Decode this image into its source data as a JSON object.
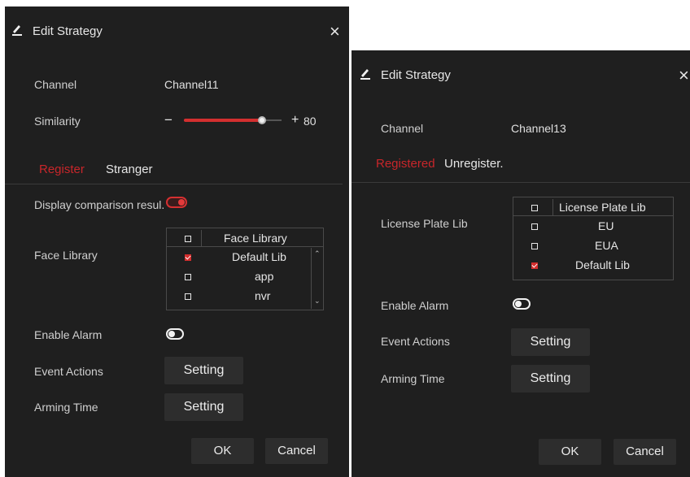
{
  "left": {
    "title": "Edit Strategy",
    "close_glyph": "×",
    "channel_label": "Channel",
    "channel_value": "Channel11",
    "similarity_label": "Similarity",
    "similarity_minus": "−",
    "similarity_plus": "+",
    "similarity_value": "80",
    "similarity_level": 0.8,
    "tabs": [
      "Register",
      "Stranger"
    ],
    "display_label": "Display comparison resul.",
    "face_library_label": "Face Library",
    "face_library_table": {
      "header": "Face Library",
      "rows": [
        {
          "name": "Default Lib",
          "checked": true
        },
        {
          "name": "app",
          "checked": false
        },
        {
          "name": "nvr",
          "checked": false
        }
      ]
    },
    "enable_alarm_label": "Enable Alarm",
    "event_actions_label": "Event Actions",
    "event_actions_button": "Setting",
    "arming_time_label": "Arming Time",
    "arming_time_button": "Setting",
    "ok_button": "OK",
    "cancel_button": "Cancel"
  },
  "right": {
    "title": "Edit Strategy",
    "close_glyph": "×",
    "channel_label": "Channel",
    "channel_value": "Channel13",
    "tabs": [
      "Registered",
      "Unregister."
    ],
    "license_plate_label": "License Plate Lib",
    "license_plate_table": {
      "header": "License Plate Lib",
      "rows": [
        {
          "name": "EU",
          "checked": false
        },
        {
          "name": "EUA",
          "checked": false
        },
        {
          "name": "Default Lib",
          "checked": true
        }
      ]
    },
    "enable_alarm_label": "Enable Alarm",
    "event_actions_label": "Event Actions",
    "event_actions_button": "Setting",
    "arming_time_label": "Arming Time",
    "arming_time_button": "Setting",
    "ok_button": "OK",
    "cancel_button": "Cancel"
  },
  "colors": {
    "accent": "#d32f2f",
    "dialog_bg": "#1f1f1f",
    "button_bg": "#2d2d2d"
  }
}
